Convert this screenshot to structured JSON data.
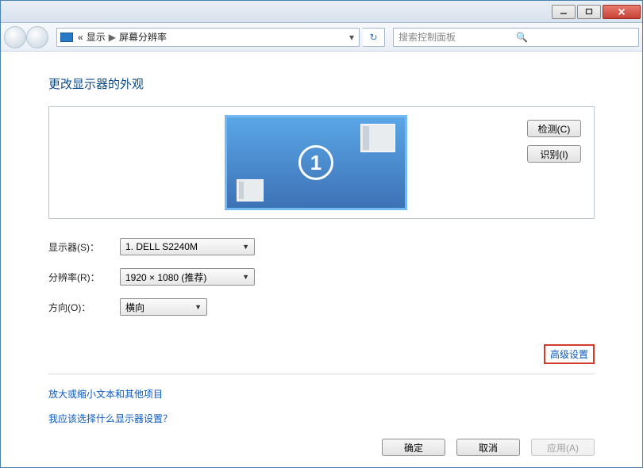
{
  "titlebar": {},
  "breadcrumb": {
    "prefix": "«",
    "part1": "显示",
    "sep": "▶",
    "part2": "屏幕分辨率"
  },
  "search": {
    "placeholder": "搜索控制面板"
  },
  "heading": "更改显示器的外观",
  "monitor_number": "1",
  "side_buttons": {
    "detect": "检测(C)",
    "identify": "识别(I)"
  },
  "form": {
    "display_label": "显示器(S)：",
    "display_value": "1. DELL S2240M",
    "resolution_label": "分辨率(R)：",
    "resolution_value": "1920 × 1080 (推荐)",
    "orientation_label": "方向(O)：",
    "orientation_value": "横向"
  },
  "advanced_link": "高级设置",
  "links": {
    "text_size": "放大或缩小文本和其他项目",
    "which_display": "我应该选择什么显示器设置？"
  },
  "footer": {
    "ok": "确定",
    "cancel": "取消",
    "apply": "应用(A)"
  }
}
